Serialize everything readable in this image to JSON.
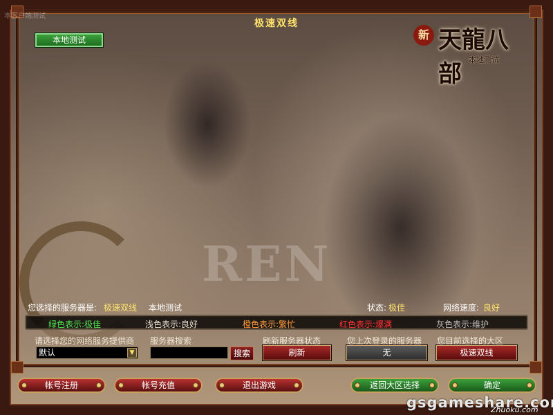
{
  "window": {
    "title": "极速双线",
    "corner_watermark": "本客户端测试"
  },
  "logo": {
    "seal": "新",
    "main": "天龍八部",
    "sub": "本地测试"
  },
  "top_button": {
    "label": "本地测试"
  },
  "selection_info": {
    "selected_label": "您选择的服务器是:",
    "selected_value": "极速双线",
    "selected_extra": "本地测试",
    "status_label": "状态:",
    "status_value": "极佳",
    "speed_label": "网络速度:",
    "speed_value": "良好"
  },
  "legend": [
    {
      "text": "绿色表示:极佳",
      "color": "#4ee04e"
    },
    {
      "text": "浅色表示:良好",
      "color": "#e8e0d0"
    },
    {
      "text": "橙色表示:繁忙",
      "color": "#ff9a3a"
    },
    {
      "text": "红色表示:爆满",
      "color": "#ff3030"
    },
    {
      "text": "灰色表示:维护",
      "color": "#bdbdbd"
    }
  ],
  "controls": {
    "isp_label": "请选择您的网络服务提供商",
    "isp_selected": "默认",
    "search_label": "服务器搜索",
    "search_value": "",
    "search_button": "搜索",
    "refresh_label": "刷新服务器状态",
    "refresh_button": "刷新",
    "last_login_label": "您上次登录的服务器",
    "last_login_value": "无",
    "current_region_label": "您目前选择的大区",
    "current_region_value": "极速双线"
  },
  "bottom_buttons": {
    "register": "帐号注册",
    "recharge": "帐号充值",
    "exit": "退出游戏",
    "back": "返回大区选择",
    "confirm": "确定"
  },
  "site": {
    "domain": "gsgameshare.com",
    "mirror": "Zhuoku.com"
  }
}
